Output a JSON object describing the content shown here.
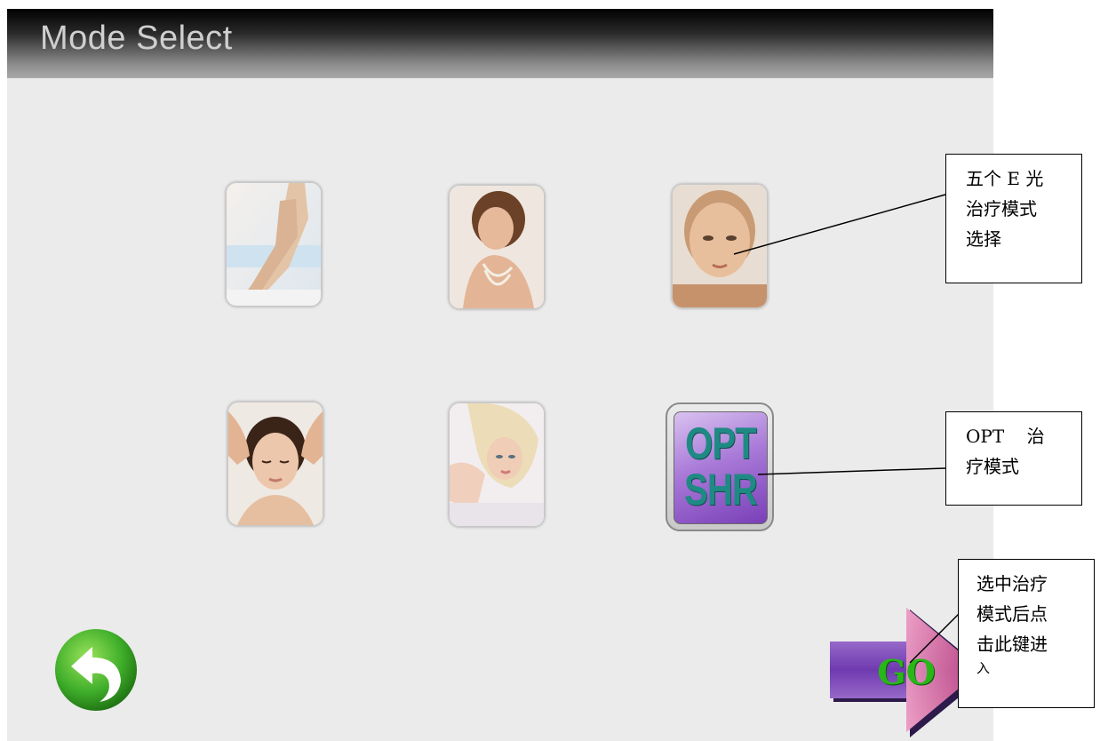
{
  "header": {
    "title": "Mode Select"
  },
  "modes": [
    {
      "id": "mode-1",
      "icon": "legs-photo-icon"
    },
    {
      "id": "mode-2",
      "icon": "woman-smiling-photo-icon"
    },
    {
      "id": "mode-3",
      "icon": "face-closeup-photo-icon"
    },
    {
      "id": "mode-4",
      "icon": "head-massage-photo-icon"
    },
    {
      "id": "mode-5",
      "icon": "blonde-woman-photo-icon"
    }
  ],
  "opt_button": {
    "line1": "OPT",
    "line2": "SHR"
  },
  "back_button": {
    "icon": "back-arrow-icon",
    "color": "#3fae2a"
  },
  "go_button": {
    "label": "GO",
    "icon": "arrow-right-icon"
  },
  "annotations": {
    "callout1": [
      "五个 E 光",
      "治疗模式",
      "选择"
    ],
    "callout2": [
      "OPT    治",
      "疗模式"
    ],
    "callout3": [
      "选中治疗",
      "模式后点",
      "击此键进",
      "入"
    ]
  },
  "colors": {
    "title_bar": "#000000",
    "screen_bg": "#ebebeb",
    "opt_text": "#1f8a84",
    "go_text": "#27b818"
  }
}
